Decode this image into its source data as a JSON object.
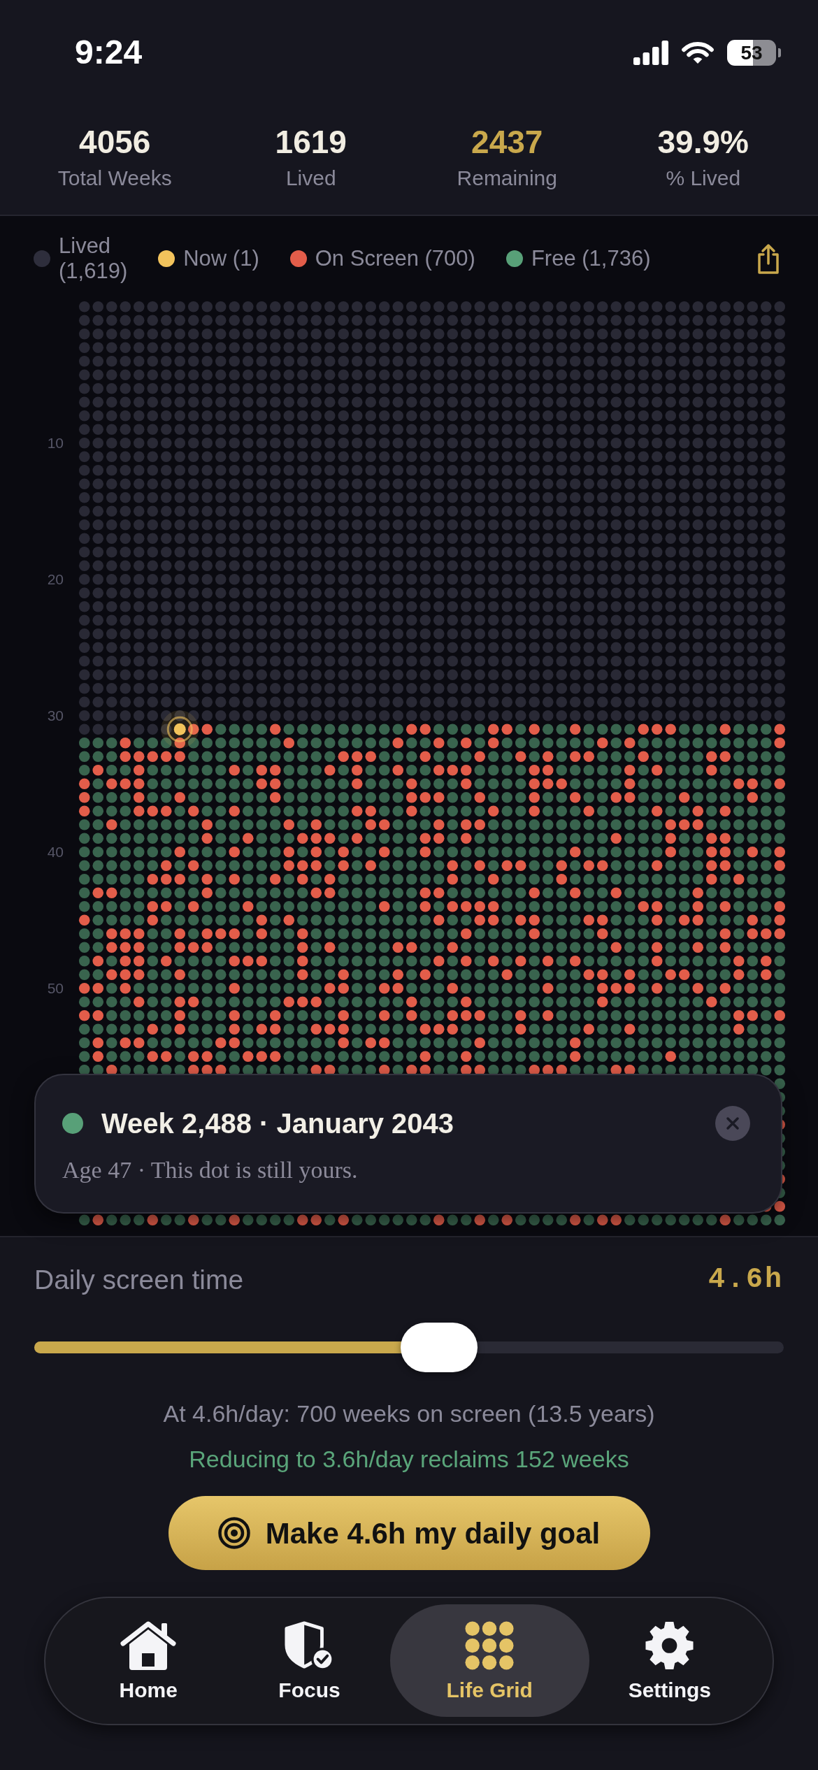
{
  "status_bar": {
    "time": "9:24",
    "battery": "53"
  },
  "stats": [
    {
      "value": "4056",
      "label": "Total Weeks",
      "highlighted": false
    },
    {
      "value": "1619",
      "label": "Lived",
      "highlighted": false
    },
    {
      "value": "2437",
      "label": "Remaining",
      "highlighted": true
    },
    {
      "value": "39.9%",
      "label": "% Lived",
      "highlighted": false
    }
  ],
  "legend": [
    {
      "label": "Lived (1,619)",
      "color": "#2e2e3c"
    },
    {
      "label": "Now (1)",
      "color": "#f2c35c"
    },
    {
      "label": "On Screen (700)",
      "color": "#e35d4a"
    },
    {
      "label": "Free (1,736)",
      "color": "#58a078"
    }
  ],
  "grid": {
    "row_labels": [
      "10",
      "20",
      "30",
      "40",
      "50"
    ]
  },
  "detail_card": {
    "title": "Week 2,488 · January 2043",
    "subtitle": "Age 47 · This dot is still yours.",
    "color": "#58a078"
  },
  "slider": {
    "label": "Daily screen time",
    "value": "4.6h",
    "level": 0.54
  },
  "summary": "At 4.6h/day: 700 weeks on screen (13.5 years)",
  "reclaim_note": "Reducing to 3.6h/day reclaims 152 weeks",
  "goal_button": {
    "label": "Make 4.6h my daily goal"
  },
  "tabs": [
    {
      "label": "Home",
      "selected": false
    },
    {
      "label": "Focus",
      "selected": false
    },
    {
      "label": "Life Grid",
      "selected": true
    },
    {
      "label": "Settings",
      "selected": false
    }
  ]
}
